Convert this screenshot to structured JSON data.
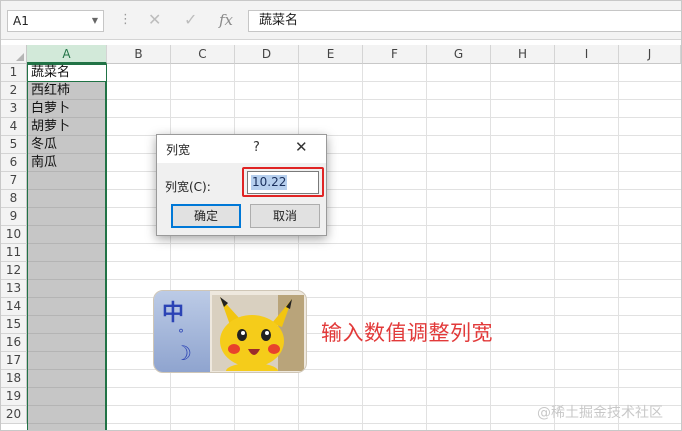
{
  "formula_bar": {
    "name_box": "A1",
    "cancel_icon": "✕",
    "enter_icon": "✓",
    "fx_icon": "fx",
    "formula_value": "蔬菜名"
  },
  "columns": [
    "A",
    "B",
    "C",
    "D",
    "E",
    "F",
    "G",
    "H",
    "I",
    "J"
  ],
  "rows": [
    "1",
    "2",
    "3",
    "4",
    "5",
    "6",
    "7",
    "8",
    "9",
    "10",
    "11",
    "12",
    "13",
    "14",
    "15",
    "16",
    "17",
    "18",
    "19",
    "20"
  ],
  "cells": {
    "A1": "蔬菜名",
    "A2": "西红柿",
    "A3": "白萝卜",
    "A4": "胡萝卜",
    "A5": "冬瓜",
    "A6": "南瓜"
  },
  "dialog": {
    "title": "列宽",
    "help": "?",
    "close": "✕",
    "label": "列宽(C):",
    "value": "10.22",
    "ok": "确定",
    "cancel": "取消"
  },
  "sticker": {
    "glyph": "中",
    "dot": "°",
    "moon": "☽"
  },
  "caption": "输入数值调整列宽",
  "watermark": "@稀土掘金技术社区",
  "colors": {
    "accent": "#217346",
    "highlight": "#e02424",
    "caption": "#e23a3a"
  }
}
